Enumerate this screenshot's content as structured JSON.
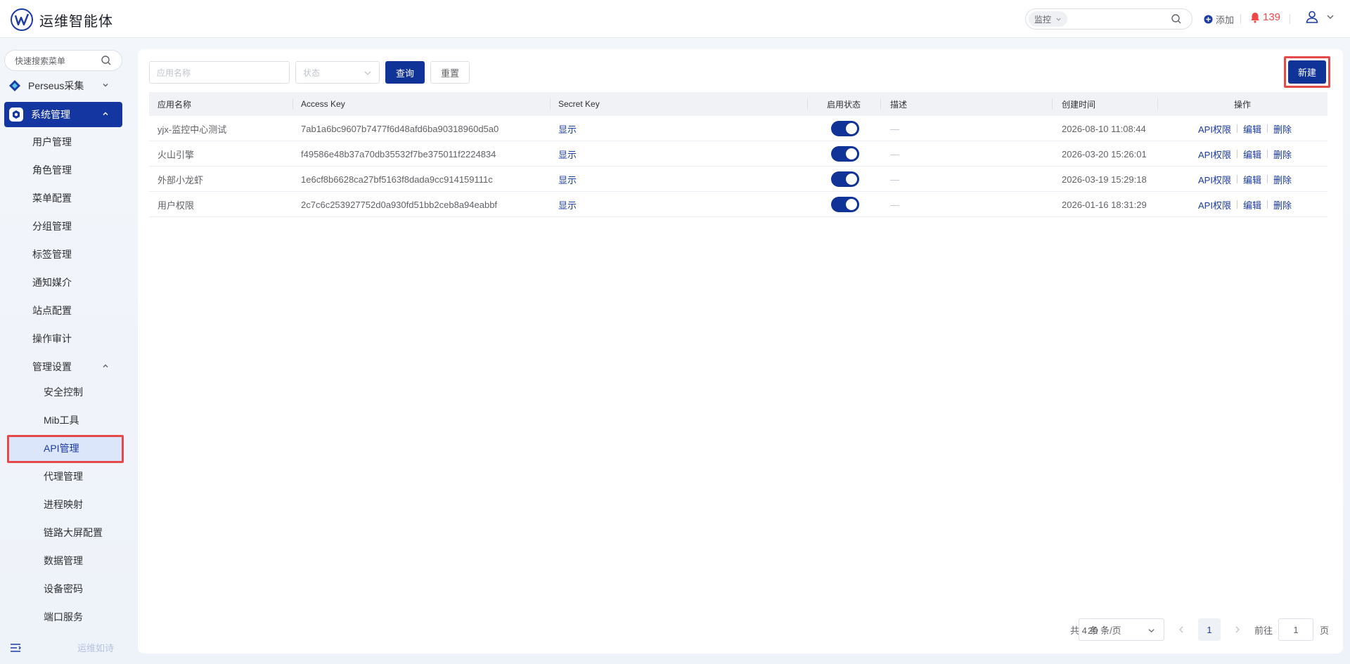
{
  "header": {
    "title": "运维智能体",
    "search_scope": "监控",
    "search_placeholder": "",
    "add_label": "添加",
    "alert_count": "139"
  },
  "sidebar": {
    "search_placeholder": "快速搜索菜单",
    "groups": [
      {
        "label": "Perseus采集"
      },
      {
        "label": "系统管理"
      }
    ],
    "items": [
      "用户管理",
      "角色管理",
      "菜单配置",
      "分组管理",
      "标签管理",
      "通知媒介",
      "站点配置",
      "操作审计",
      "管理设置"
    ],
    "sub_items": [
      "安全控制",
      "Mib工具",
      "API管理",
      "代理管理",
      "进程映射",
      "链路大屏配置",
      "数据管理",
      "设备密码",
      "端口服务"
    ],
    "bottom_text": "运维如诗"
  },
  "filters": {
    "name_placeholder": "应用名称",
    "status_placeholder": "状态",
    "query_label": "查询",
    "reset_label": "重置",
    "new_label": "新建"
  },
  "table": {
    "columns": [
      "应用名称",
      "Access Key",
      "Secret Key",
      "启用状态",
      "描述",
      "创建时间",
      "操作"
    ],
    "rows": [
      {
        "name": "yjx-监控中心测试",
        "access_key": "7ab1a6bc9607b7477f6d48afd6ba90318960d5a0",
        "secret": "显示",
        "enabled": true,
        "desc": "—",
        "created": "2026-08-10 11:08:44"
      },
      {
        "name": "火山引擎",
        "access_key": "f49586e48b37a70db35532f7be375011f2224834",
        "secret": "显示",
        "enabled": true,
        "desc": "—",
        "created": "2026-03-20 15:26:01"
      },
      {
        "name": "外部小龙虾",
        "access_key": "1e6cf8b6628ca27bf5163f8dada9cc914159111c",
        "secret": "显示",
        "enabled": true,
        "desc": "—",
        "created": "2026-03-19 15:29:18"
      },
      {
        "name": "用户权限",
        "access_key": "2c7c6c253927752d0a930fd51bb2ceb8a94eabbf",
        "secret": "显示",
        "enabled": true,
        "desc": "—",
        "created": "2026-01-16 18:31:29"
      }
    ],
    "ops": [
      "API权限",
      "编辑",
      "删除"
    ]
  },
  "pagination": {
    "total": "共 4 条",
    "page_size": "20 条/页",
    "current_page": "1",
    "goto_label": "前往",
    "goto_value": "1",
    "page_unit": "页"
  },
  "colors": {
    "primary": "#0f3396",
    "highlight": "#e44a4a",
    "alert": "#f04848"
  }
}
